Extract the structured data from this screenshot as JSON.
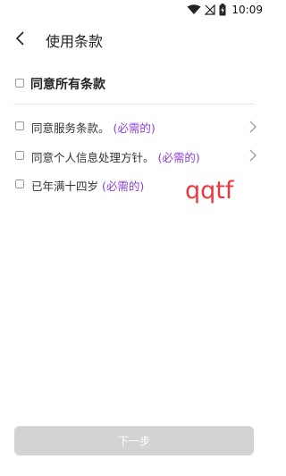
{
  "status_bar": {
    "time": "10:09",
    "icons": [
      "wifi-icon",
      "no-signal-icon",
      "battery-charging-icon"
    ]
  },
  "header": {
    "back_icon": "chevron-left-icon",
    "title": "使用条款"
  },
  "agree_all": {
    "label": "同意所有条款"
  },
  "terms": [
    {
      "label": "同意服务条款。",
      "required": "(必需的)",
      "has_arrow": true
    },
    {
      "label": "同意个人信息处理方针。",
      "required": "(必需的)",
      "has_arrow": true
    },
    {
      "label": "已年满十四岁",
      "required": "(必需的)",
      "has_arrow": false
    }
  ],
  "watermark": "qqtf",
  "footer": {
    "next_label": "下一步"
  },
  "colors": {
    "required": "#8e3fd1",
    "button_disabled": "#d3d3d3",
    "watermark": "#e8393f"
  }
}
